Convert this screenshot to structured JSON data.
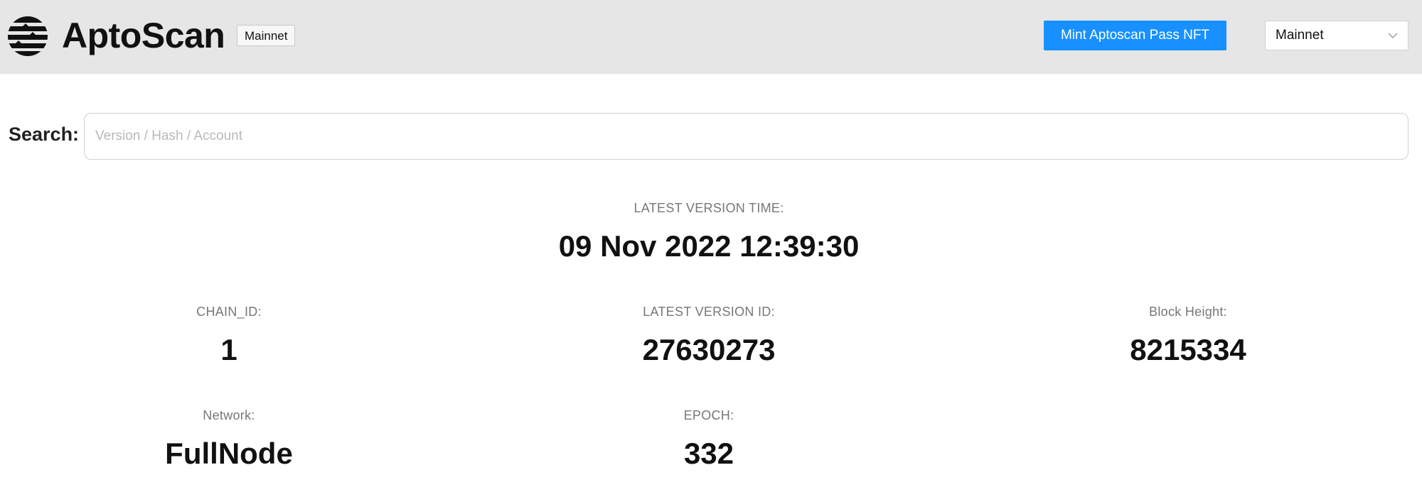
{
  "header": {
    "brand": "AptoScan",
    "network_badge": "Mainnet",
    "mint_button_label": "Mint Aptoscan Pass NFT",
    "network_select_value": "Mainnet",
    "logo_icon": "aptos-logo-icon",
    "select_icon": "chevron-down-icon"
  },
  "search": {
    "label": "Search:",
    "placeholder": "Version / Hash / Account",
    "value": ""
  },
  "stats": {
    "latest_version_time": {
      "label": "LATEST VERSION TIME:",
      "value": "09 Nov 2022 12:39:30"
    },
    "chain_id": {
      "label": "CHAIN_ID:",
      "value": "1"
    },
    "latest_version_id": {
      "label": "LATEST VERSION ID:",
      "value": "27630273"
    },
    "block_height": {
      "label": "Block Height:",
      "value": "8215334"
    },
    "network": {
      "label": "Network:",
      "value": "FullNode"
    },
    "epoch": {
      "label": "EPOCH:",
      "value": "332"
    }
  },
  "colors": {
    "header_bg": "#e6e6e6",
    "accent": "#1890ff",
    "label_gray": "#777777"
  }
}
